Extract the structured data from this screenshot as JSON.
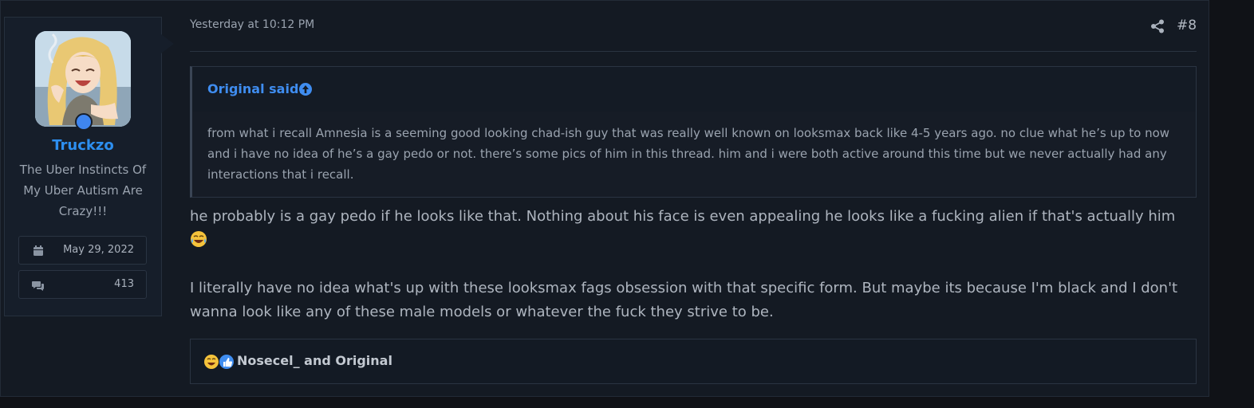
{
  "user": {
    "username": "Truckzo",
    "title": "The Uber Instincts Of My Uber Autism Are Crazy!!!",
    "joined": "May 29, 2022",
    "messages": "413",
    "avatar_icon": "anime-character-avatar",
    "online_color": "#3f86f0"
  },
  "post": {
    "date": "Yesterday at 10:12 PM",
    "number": "#8",
    "share_icon": "share-icon"
  },
  "quote": {
    "author": "Original said:",
    "text": "from what i recall Amnesia is a seeming good looking chad-ish guy that was really well known on looksmax back like 4-5 years ago. no clue what he’s up to now and i have no idea of he’s a gay pedo or not. there’s some pics of him in this thread. him and i were both active around this time but we never actually had any interactions that i recall."
  },
  "message": {
    "paragraph1": "he probably is a gay pedo if he looks like that. Nothing about his face is even appealing he looks like a fucking alien if that's actually him",
    "paragraph1_emoji": "crying-laughing-emoji",
    "paragraph2": "I literally have no idea what's up with these looksmax fags obsession with that specific form. But maybe its because I'm black and I don't wanna look like any of these male models or whatever the fuck they strive to be."
  },
  "reactions": {
    "icons": [
      "crying-laughing-emoji",
      "thumbs-up-emoji"
    ],
    "text": "Nosecel_ and Original"
  },
  "colors": {
    "accent": "#2d8ff0",
    "background": "#141a23"
  }
}
